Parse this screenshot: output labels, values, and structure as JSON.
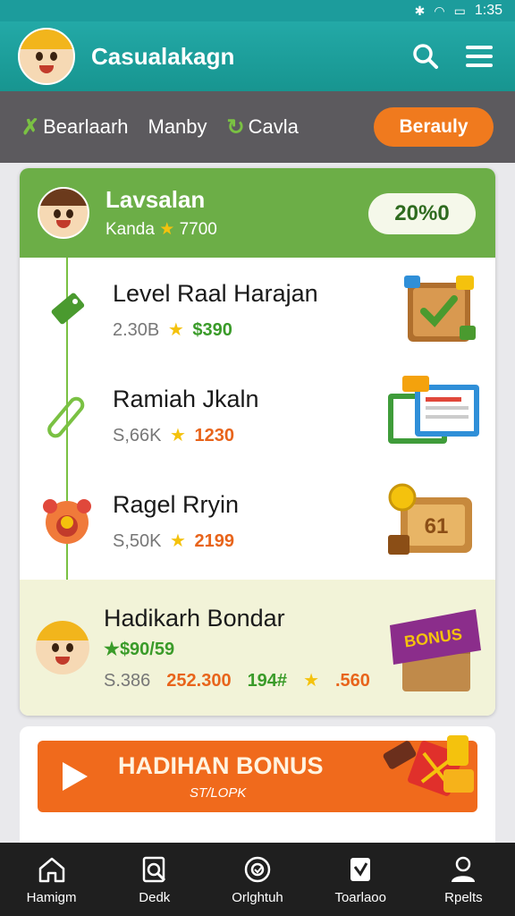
{
  "status": {
    "time": "1:35"
  },
  "header": {
    "title": "Casualakagn"
  },
  "filters": {
    "items": [
      {
        "label": "Bearlaarh",
        "icon": "check-icon"
      },
      {
        "label": "Manby",
        "icon": ""
      },
      {
        "label": "Cavla",
        "icon": "refresh-icon"
      }
    ],
    "button_label": "Berauly"
  },
  "card": {
    "title": "Lavsalan",
    "sub_label": "Kanda",
    "sub_value": "7700",
    "percent": "20%0"
  },
  "rows": [
    {
      "title": "Level Raal Harajan",
      "meta_count": "2.30B",
      "meta_value": "$390",
      "value_color": "green"
    },
    {
      "title": "Ramiah Jkaln",
      "meta_count": "S,66K",
      "meta_value": "1230",
      "value_color": "orange"
    },
    {
      "title": "Ragel Rryin",
      "meta_count": "S,50K",
      "meta_value": "2199",
      "value_color": "orange"
    }
  ],
  "bonus_row": {
    "title": "Hadikarh Bondar",
    "reward": "$90/59",
    "stat1": "S.386",
    "stat2": "252.300",
    "stat3": "194#",
    "stat4": ".560",
    "badge": "BONUS"
  },
  "banner": {
    "title": "HADIHAN BONUS",
    "subtitle": "ST/LOPK"
  },
  "nav": [
    {
      "label": "Hamigm",
      "icon": "home-icon"
    },
    {
      "label": "Dedk",
      "icon": "search-doc-icon"
    },
    {
      "label": "Orlghtuh",
      "icon": "game-icon"
    },
    {
      "label": "Toarlaoo",
      "icon": "card-icon"
    },
    {
      "label": "Rpelts",
      "icon": "profile-icon"
    }
  ],
  "colors": {
    "header": "#1c9c9c",
    "accent": "#f06a1c",
    "card_green": "#6cae47"
  }
}
